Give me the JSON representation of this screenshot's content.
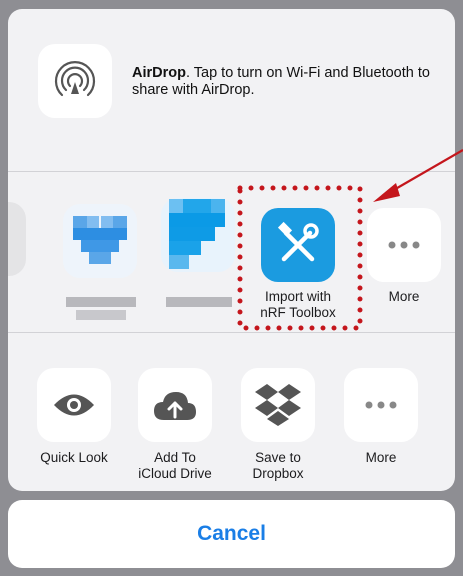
{
  "airdrop": {
    "title": "AirDrop",
    "message": ". Tap to turn on Wi-Fi and Bluetooth to share with AirDrop."
  },
  "apps": [
    {
      "label": "",
      "icon": "blurred-app-icon"
    },
    {
      "label": "",
      "icon": "blurred-dropbox-icon"
    },
    {
      "label": "",
      "icon": "blurred-app-icon"
    },
    {
      "label_line1": "Import with",
      "label_line2": "nRF Toolbox",
      "icon": "tools-icon"
    },
    {
      "label": "More",
      "icon": "more-icon"
    }
  ],
  "actions": [
    {
      "label_line1": "Quick Look",
      "label_line2": "",
      "icon": "eye-icon"
    },
    {
      "label_line1": "Add To",
      "label_line2": "iCloud Drive",
      "icon": "cloud-upload-icon"
    },
    {
      "label_line1": "Save to",
      "label_line2": "Dropbox",
      "icon": "dropbox-icon"
    },
    {
      "label_line1": "More",
      "label_line2": "",
      "icon": "more-icon"
    }
  ],
  "cancel_label": "Cancel",
  "colors": {
    "accent": "#1a7ee6",
    "highlight_dots": "#c4161c",
    "toolbox_tile": "#1b9be0"
  }
}
